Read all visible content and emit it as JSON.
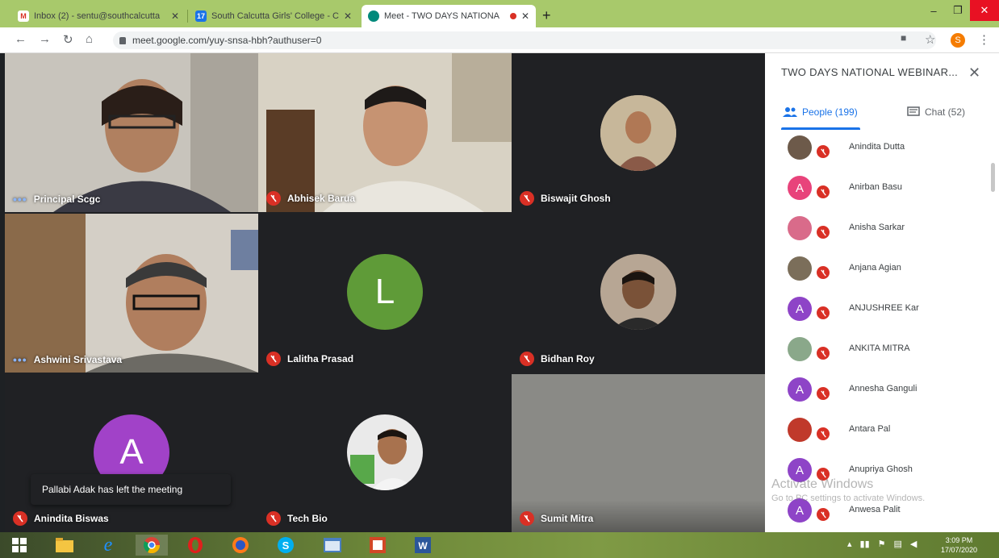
{
  "browser": {
    "tabs": [
      {
        "title": "Inbox (2) - sentu@southcalcutta",
        "favicon_color": "#d93025",
        "favicon_glyph": "M",
        "active": false
      },
      {
        "title": "South Calcutta Girls' College - Ca",
        "favicon_color": "#1a73e8",
        "favicon_glyph": "17",
        "active": false
      },
      {
        "title": "Meet - TWO DAYS NATIONA",
        "favicon_color": "#00897b",
        "favicon_glyph": "",
        "active": true
      }
    ],
    "url": "meet.google.com/yuy-snsa-hbh?authuser=0",
    "profile_initial": "S"
  },
  "meeting": {
    "tiles": [
      {
        "name": "Principal Scgc",
        "indicator": "speaking",
        "kind": "photo"
      },
      {
        "name": "Abhisek Barua",
        "indicator": "muted",
        "kind": "photo"
      },
      {
        "name": "Biswajit Ghosh",
        "indicator": "muted",
        "kind": "avatar-photo"
      },
      {
        "name": "Ashwini Srivastava",
        "indicator": "speaking",
        "kind": "photo"
      },
      {
        "name": "Lalitha Prasad",
        "indicator": "muted",
        "kind": "avatar-letter",
        "letter": "L",
        "color": "#5f9b38"
      },
      {
        "name": "Bidhan Roy",
        "indicator": "muted",
        "kind": "avatar-photo"
      },
      {
        "name": "Anindita Biswas",
        "indicator": "muted",
        "kind": "avatar-letter",
        "letter": "A",
        "color": "#a142c8"
      },
      {
        "name": "Tech Bio",
        "indicator": "muted",
        "kind": "avatar-photo"
      },
      {
        "name": "Sumit Mitra",
        "indicator": "muted",
        "kind": "blank"
      }
    ],
    "toast": "Pallabi Adak has left the meeting"
  },
  "panel": {
    "title": "TWO DAYS NATIONAL WEBINAR...",
    "tab_people": "People (199)",
    "tab_chat": "Chat (52)",
    "people": [
      {
        "name": "Anindita Dutta",
        "avatar": "photo",
        "color": "#6d5a4a"
      },
      {
        "name": "Anirban Basu",
        "avatar": "letter",
        "letter": "A",
        "color": "#e8437b"
      },
      {
        "name": "Anisha Sarkar",
        "avatar": "photo",
        "color": "#d96b8a"
      },
      {
        "name": "Anjana Agian",
        "avatar": "photo",
        "color": "#7b6e5a"
      },
      {
        "name": "ANJUSHREE Kar",
        "avatar": "letter",
        "letter": "A",
        "color": "#8e44c7"
      },
      {
        "name": "ANKITA MITRA",
        "avatar": "photo",
        "color": "#8aa88a"
      },
      {
        "name": "Annesha Ganguli",
        "avatar": "letter",
        "letter": "A",
        "color": "#8e44c7"
      },
      {
        "name": "Antara Pal",
        "avatar": "photo",
        "color": "#c0392b"
      },
      {
        "name": "Anupriya Ghosh",
        "avatar": "letter",
        "letter": "A",
        "color": "#8e44c7"
      },
      {
        "name": "Anwesa Palit",
        "avatar": "letter",
        "letter": "A",
        "color": "#8e44c7"
      }
    ],
    "watermark_line1": "Activate Windows",
    "watermark_line2": "Go to PC settings to activate Windows."
  },
  "taskbar": {
    "apps": [
      "windows-start",
      "file-explorer",
      "internet-explorer",
      "chrome",
      "opera",
      "firefox",
      "skype",
      "window-app",
      "presentation",
      "word"
    ],
    "time": "3:09 PM",
    "date": "17/07/2020"
  }
}
